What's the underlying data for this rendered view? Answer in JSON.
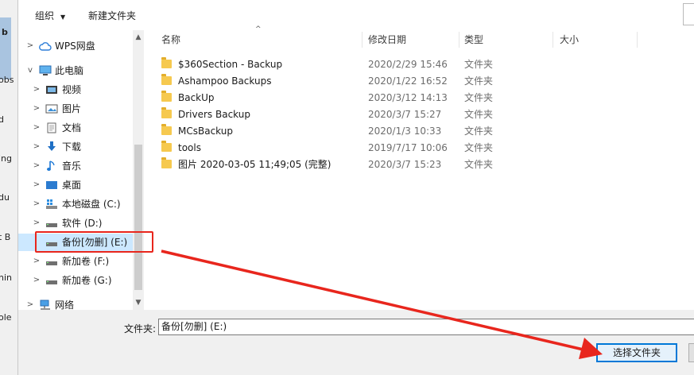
{
  "background_window": {
    "fragments": [
      "b",
      "obs",
      "d",
      "ing",
      "du",
      "t B",
      "hin",
      "ole"
    ]
  },
  "toolbar": {
    "organize_label": "组织",
    "new_folder_label": "新建文件夹"
  },
  "nav": {
    "items": [
      {
        "label": "WPS网盘",
        "icon": "cloud-icon"
      },
      {
        "label": "此电脑",
        "icon": "computer-icon"
      },
      {
        "label": "视频",
        "icon": "video-folder-icon"
      },
      {
        "label": "图片",
        "icon": "pictures-folder-icon"
      },
      {
        "label": "文档",
        "icon": "documents-folder-icon"
      },
      {
        "label": "下载",
        "icon": "download-arrow-icon"
      },
      {
        "label": "音乐",
        "icon": "music-note-icon"
      },
      {
        "label": "桌面",
        "icon": "desktop-icon"
      },
      {
        "label": "本地磁盘 (C:)",
        "icon": "windows-drive-icon"
      },
      {
        "label": "软件 (D:)",
        "icon": "drive-icon"
      },
      {
        "label": "备份[勿删] (E:)",
        "icon": "drive-icon"
      },
      {
        "label": "新加卷 (F:)",
        "icon": "drive-icon"
      },
      {
        "label": "新加卷 (G:)",
        "icon": "drive-icon"
      },
      {
        "label": "网络",
        "icon": "network-icon"
      }
    ],
    "selected": "备份[勿删] (E:)"
  },
  "columns": {
    "name": "名称",
    "modified": "修改日期",
    "type": "类型",
    "size": "大小"
  },
  "files": [
    {
      "name": "$360Section - Backup",
      "modified": "2020/2/29 15:46",
      "type": "文件夹"
    },
    {
      "name": "Ashampoo Backups",
      "modified": "2020/1/22 16:52",
      "type": "文件夹"
    },
    {
      "name": "BackUp",
      "modified": "2020/3/12 14:13",
      "type": "文件夹"
    },
    {
      "name": "Drivers Backup",
      "modified": "2020/3/7 15:27",
      "type": "文件夹"
    },
    {
      "name": "MCsBackup",
      "modified": "2020/1/3 10:33",
      "type": "文件夹"
    },
    {
      "name": "tools",
      "modified": "2019/7/17 10:06",
      "type": "文件夹"
    },
    {
      "name": "图片 2020-03-05 11;49;05 (完整)",
      "modified": "2020/3/7 15:23",
      "type": "文件夹"
    }
  ],
  "footer": {
    "folder_label": "文件夹:",
    "folder_value": "备份[勿删] (E:)",
    "select_button": "选择文件夹"
  },
  "colors": {
    "annotation_red": "#e8261d",
    "selection_blue": "#cce8ff",
    "button_blue": "#0078d7"
  }
}
